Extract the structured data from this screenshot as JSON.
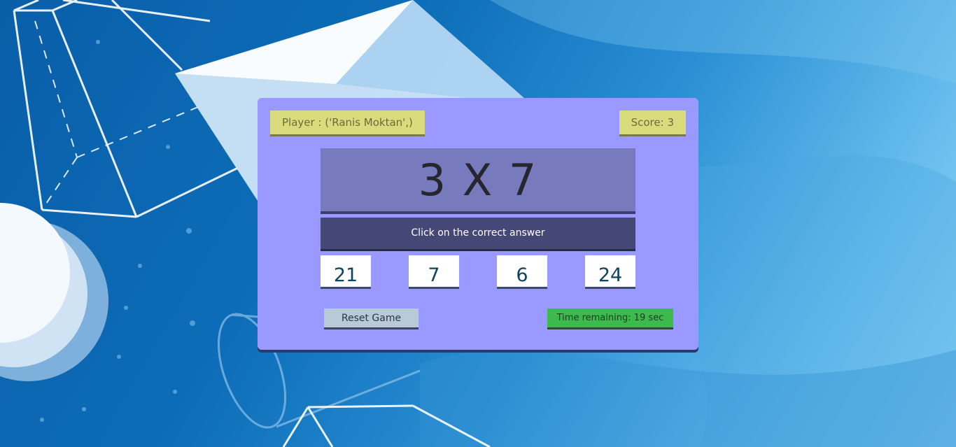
{
  "header": {
    "player_label": "Player : ('Ranis Moktan',)",
    "score_label": "Score: 3"
  },
  "question": {
    "text": "3 X 7"
  },
  "instruction": {
    "text": "Click on the correct answer"
  },
  "choices": [
    {
      "label": "21"
    },
    {
      "label": "7"
    },
    {
      "label": "6"
    },
    {
      "label": "24"
    }
  ],
  "controls": {
    "reset_label": "Reset Game",
    "timer_label": "Time remaining: 19 sec"
  },
  "colors": {
    "card": "#9999ff",
    "question_panel": "#777bbd",
    "instruction_panel": "#454876",
    "sticky": "#d8dc7c",
    "timer": "#3cba4e",
    "reset": "#b8cad8"
  }
}
